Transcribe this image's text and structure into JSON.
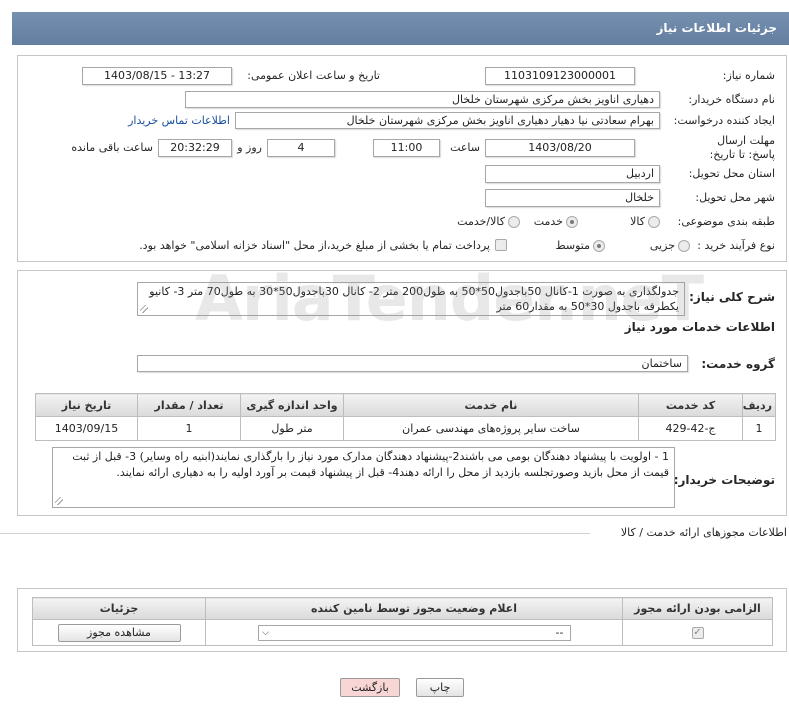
{
  "header": {
    "title": "جزئیات اطلاعات نیاز"
  },
  "details": {
    "need_number": {
      "label": "شماره نیاز:",
      "value": "1103109123000001"
    },
    "announce_datetime": {
      "label": "تاریخ و ساعت اعلان عمومی:",
      "value": "1403/08/15 - 13:27"
    },
    "buyer_org": {
      "label": "نام دستگاه خریدار:",
      "value": "دهیاری اناویز بخش مرکزی شهرستان خلخال"
    },
    "requester": {
      "label": "ایجاد کننده درخواست:",
      "value": "بهرام سعادتی نیا دهیار دهیاری اناویز بخش مرکزی شهرستان خلخال",
      "contact_link": "اطلاعات تماس خریدار"
    },
    "deadline": {
      "label": "مهلت ارسال پاسخ: تا تاریخ:",
      "date": "1403/08/20",
      "time_label": "ساعت",
      "time": "11:00",
      "days": "4",
      "days_label": "روز و",
      "remaining_time": "20:32:29",
      "remaining_label": "ساعت باقی مانده"
    },
    "province": {
      "label": "استان محل تحویل:",
      "value": "اردبیل"
    },
    "city": {
      "label": "شهر محل تحویل:",
      "value": "خلخال"
    },
    "category": {
      "label": "طبقه بندی موضوعی:",
      "options": [
        {
          "label": "کالا",
          "selected": false
        },
        {
          "label": "خدمت",
          "selected": true
        },
        {
          "label": "کالا/خدمت",
          "selected": false
        }
      ]
    },
    "process_type": {
      "label": "نوع فرآیند خرید :",
      "options": [
        {
          "label": "جزیی",
          "selected": false
        },
        {
          "label": "متوسط",
          "selected": true
        }
      ],
      "treasury_note": "پرداخت تمام یا بخشی از مبلغ خرید،از محل \"اسناد خزانه اسلامی\" خواهد بود.",
      "treasury_checked": false
    }
  },
  "description": {
    "label": "شرح کلی نیاز:",
    "value": "جدولگذاری  به صورت 1-کانال 50باجدول50*50  به طول200 متر 2- کانال 30باجدول50*30  به طول70 متر 3- کانیو یکطرفه   باجدول  30*50 به مقدار60 متر"
  },
  "services": {
    "heading": "اطلاعات خدمات مورد نیاز",
    "group_label": "گروه خدمت:",
    "group_value": "ساختمان",
    "columns": [
      "ردیف",
      "کد خدمت",
      "نام خدمت",
      "واحد اندازه گیری",
      "تعداد / مقدار",
      "تاریخ نیاز"
    ],
    "rows": [
      [
        "1",
        "ج-42-429",
        "ساخت سایر پروژه‌های مهندسی عمران",
        "متر طول",
        "1",
        "1403/09/15"
      ]
    ]
  },
  "buyer_notes": {
    "label": "توضیحات خریدار:",
    "value": "1 - اولویت با پیشنهاد دهندگان بومی  می باشند2-پیشنهاد دهندگان مدارک مورد نیاز را بارگذاری نمایند(ابنیه راه وسایر) 3- قبل از ثبت قیمت از محل بازید وصورتجلسه بازدید از محل را ارائه دهند4- قبل از پیشنهاد قیمت بر آورد اولیه را به دهیاری ارائه نمایند."
  },
  "licenses": {
    "section_title": "اطلاعات مجوزهای ارائه خدمت / کالا",
    "columns": [
      "الزامی بودن ارائه مجوز",
      "اعلام وضعیت مجوز توسط نامین کننده",
      "جزئیات"
    ],
    "rows": [
      {
        "required": true,
        "status": "--",
        "action": "مشاهده مجوز"
      }
    ]
  },
  "actions": {
    "print": "چاپ",
    "back": "بازگشت"
  },
  "watermark": "AriaTender.neT",
  "icons": {
    "dropdown": "chevron-down-icon",
    "checkbox_mark": "check-icon",
    "resize": "resize-grip-icon"
  },
  "colors": {
    "header_bg": "#7590b0",
    "link": "#1a4fa0",
    "back_button_bg": "#f9d6d6"
  }
}
